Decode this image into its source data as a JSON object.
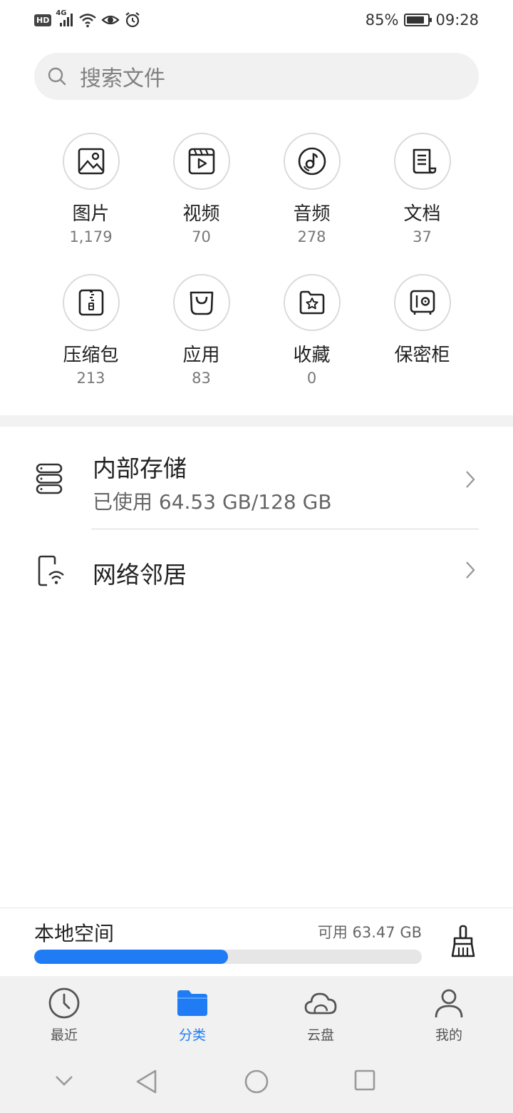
{
  "status_bar": {
    "left_icons": [
      "hd-badge-icon",
      "4g-signal-icon",
      "wifi-icon",
      "eye-icon",
      "alarm-icon"
    ],
    "hd_label": "HD",
    "net_label": "4G",
    "battery_percent": "85%",
    "battery_level": 0.85,
    "time": "09:28"
  },
  "search": {
    "placeholder": "搜索文件",
    "icon": "search-icon"
  },
  "categories": [
    {
      "label": "图片",
      "count": "1,179",
      "icon": "image-icon"
    },
    {
      "label": "视频",
      "count": "70",
      "icon": "video-icon"
    },
    {
      "label": "音频",
      "count": "278",
      "icon": "audio-icon"
    },
    {
      "label": "文档",
      "count": "37",
      "icon": "document-icon"
    },
    {
      "label": "压缩包",
      "count": "213",
      "icon": "archive-icon"
    },
    {
      "label": "应用",
      "count": "83",
      "icon": "app-bag-icon"
    },
    {
      "label": "收藏",
      "count": "0",
      "icon": "favorites-icon"
    },
    {
      "label": "保密柜",
      "count": "",
      "icon": "safe-icon"
    }
  ],
  "storage_list": [
    {
      "title": "内部存储",
      "subtitle": "已使用 64.53 GB/128 GB",
      "icon": "storage-icon"
    },
    {
      "title": "网络邻居",
      "subtitle": "",
      "icon": "network-neighbor-icon"
    }
  ],
  "local_space": {
    "title": "本地空间",
    "available": "可用 63.47 GB",
    "used_fraction": 0.5,
    "clean_icon": "broom-icon"
  },
  "tabs": [
    {
      "label": "最近",
      "icon": "clock-icon",
      "active": false
    },
    {
      "label": "分类",
      "icon": "folder-icon",
      "active": true
    },
    {
      "label": "云盘",
      "icon": "cloud-icon",
      "active": false
    },
    {
      "label": "我的",
      "icon": "person-icon",
      "active": false
    }
  ],
  "nav_bar": [
    "collapse-icon",
    "back-icon",
    "home-icon",
    "recents-icon"
  ],
  "colors": {
    "accent": "#1f7cf5",
    "search_bg": "#f1f1f1",
    "tab_bg": "#f1f1f1",
    "text_primary": "#222222",
    "text_secondary": "#777777"
  }
}
